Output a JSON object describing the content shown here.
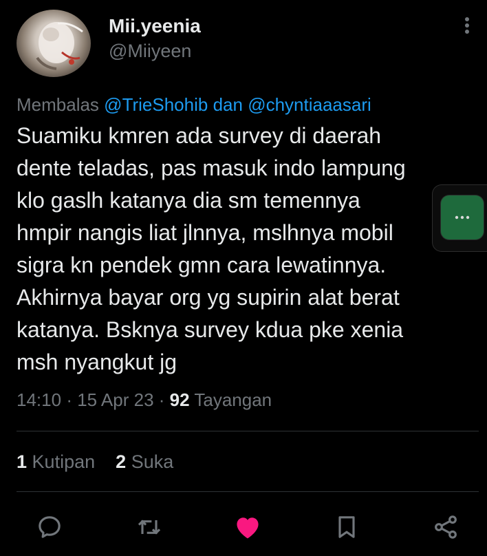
{
  "author": {
    "name": "Mii.yeenia",
    "handle": "@Miiyeen"
  },
  "reply": {
    "prefix": "Membalas",
    "mention1": "@TrieShohib",
    "joiner": "dan",
    "mention2": "@chyntiaaasari"
  },
  "tweet": {
    "lines": [
      "Suamiku kmren ada survey di daerah",
      "dente teladas, pas masuk indo lampung",
      "klo gaslh katanya dia sm temennya",
      "hmpir nangis liat jlnnya, mslhnya mobil",
      "sigra kn pendek gmn cara lewatinnya.",
      "Akhirnya bayar org yg supirin alat berat",
      "katanya. Bsknya survey kdua pke xenia",
      "msh nyangkut jg"
    ]
  },
  "meta": {
    "time": "14:10",
    "sep1": "·",
    "date": "15 Apr 23",
    "sep2": "·",
    "views_count": "92",
    "views_label": "Tayangan"
  },
  "stats": {
    "quotes_count": "1",
    "quotes_label": "Kutipan",
    "likes_count": "2",
    "likes_label": "Suka"
  },
  "actions": {
    "reply_icon": "reply-icon",
    "retweet_icon": "retweet-icon",
    "like_icon": "heart-icon",
    "bookmark_icon": "bookmark-icon",
    "share_icon": "share-icon"
  },
  "colors": {
    "background": "#000000",
    "text": "#e7e9ea",
    "muted": "#71767b",
    "mention": "#1d9bf0",
    "liked": "#f91880",
    "floating_button": "#1e6a3c"
  }
}
